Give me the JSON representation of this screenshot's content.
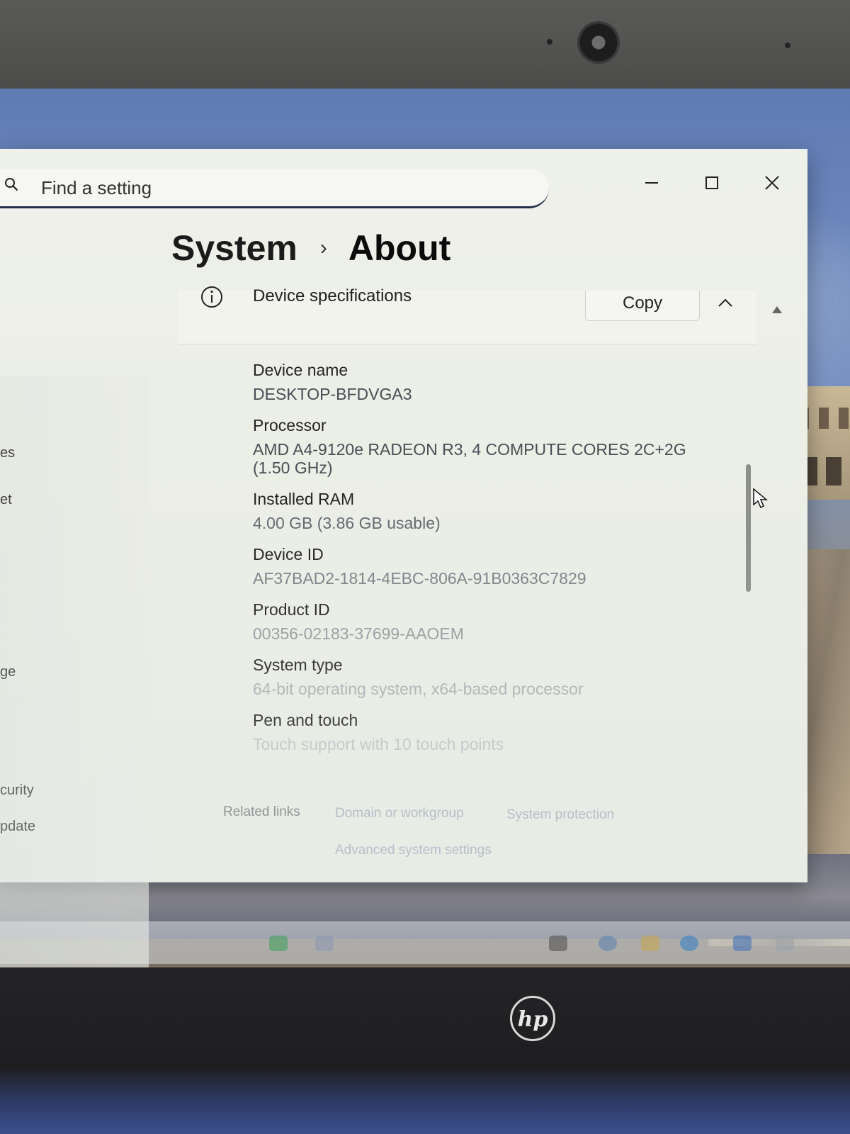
{
  "search": {
    "placeholder": "Find a setting"
  },
  "breadcrumb": {
    "parent": "System",
    "current": "About"
  },
  "left_nav": [
    "es",
    "et",
    "ge",
    "curity",
    "pdate"
  ],
  "device_specs": {
    "title": "Device specifications",
    "copy_label": "Copy",
    "items": [
      {
        "label": "Device name",
        "value": "DESKTOP-BFDVGA3"
      },
      {
        "label": "Processor",
        "value": "AMD A4-9120e RADEON R3, 4 COMPUTE CORES 2C+2G",
        "value_line2": "(1.50 GHz)"
      },
      {
        "label": "Installed RAM",
        "value": "4.00 GB (3.86 GB usable)"
      },
      {
        "label": "Device ID",
        "value": "AF37BAD2-1814-4EBC-806A-91B0363C7829"
      },
      {
        "label": "Product ID",
        "value": "00356-02183-37699-AAOEM"
      },
      {
        "label": "System type",
        "value": "64-bit operating system, x64-based processor"
      },
      {
        "label": "Pen and touch",
        "value": "Touch support with 10 touch points"
      }
    ]
  },
  "related_links": {
    "label": "Related links",
    "links": [
      "Domain or workgroup",
      "System protection",
      "Advanced system settings"
    ]
  },
  "icons": [
    "search-icon",
    "minimize-icon",
    "maximize-icon",
    "close-icon",
    "info-icon",
    "chevron-up-icon",
    "hp-logo"
  ]
}
